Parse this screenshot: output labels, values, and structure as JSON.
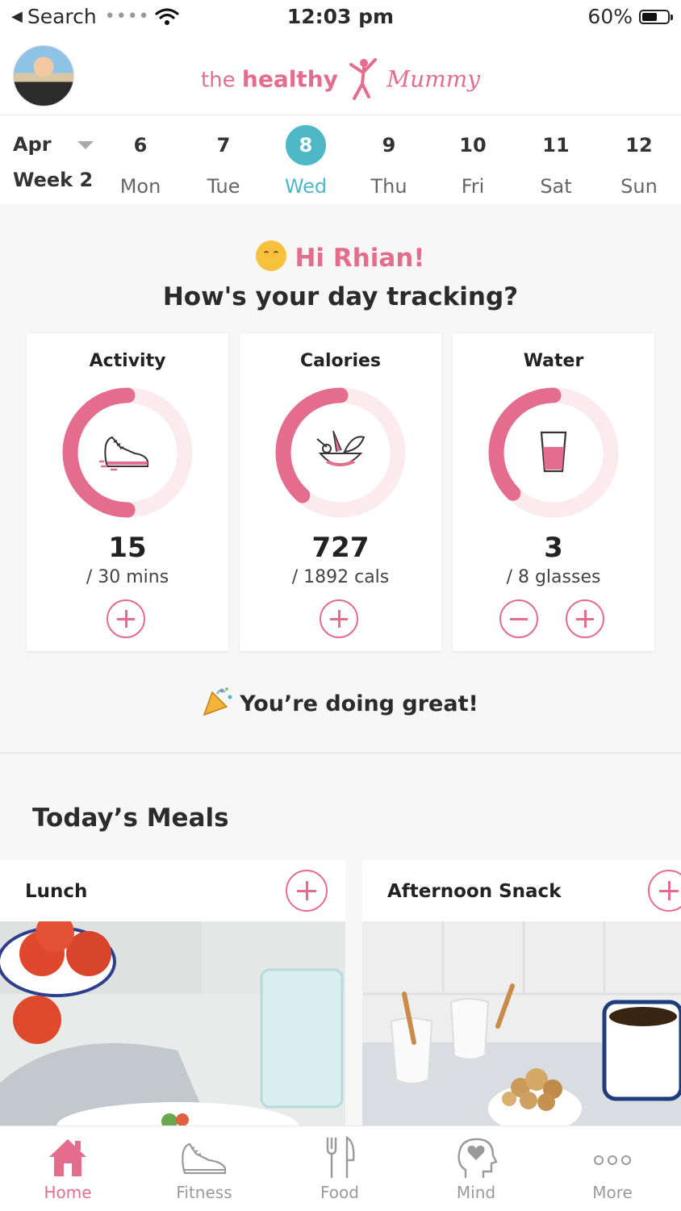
{
  "status_bar": {
    "back_app": "Search",
    "time": "12:03 pm",
    "battery": "60%",
    "battery_level": 0.6
  },
  "header": {
    "logo_the": "the",
    "logo_healthy": "healthy",
    "logo_mummy": "Mummy"
  },
  "week": {
    "month": "Apr",
    "week_label": "Week 2",
    "days": [
      {
        "num": "6",
        "name": "Mon"
      },
      {
        "num": "7",
        "name": "Tue"
      },
      {
        "num": "8",
        "name": "Wed"
      },
      {
        "num": "9",
        "name": "Thu"
      },
      {
        "num": "10",
        "name": "Fri"
      },
      {
        "num": "11",
        "name": "Sat"
      },
      {
        "num": "12",
        "name": "Sun"
      }
    ],
    "active_index": 2
  },
  "greeting": {
    "hi": "Hi Rhian!",
    "question": "How's your day tracking?"
  },
  "tracking": {
    "activity": {
      "title": "Activity",
      "value": "15",
      "target": "/ 30 mins",
      "progress": 0.5,
      "icon": "sneaker-icon"
    },
    "calories": {
      "title": "Calories",
      "value": "727",
      "target": "/ 1892 cals",
      "progress": 0.384,
      "icon": "salad-bowl-icon"
    },
    "water": {
      "title": "Water",
      "value": "3",
      "target": "/ 8 glasses",
      "progress": 0.375,
      "icon": "water-glass-icon"
    }
  },
  "encouragement": "You’re doing great!",
  "meals": {
    "title": "Today’s Meals",
    "items": [
      {
        "label": "Lunch"
      },
      {
        "label": "Afternoon Snack"
      }
    ]
  },
  "tabbar": {
    "items": [
      {
        "label": "Home",
        "icon": "home-icon"
      },
      {
        "label": "Fitness",
        "icon": "sneaker-icon"
      },
      {
        "label": "Food",
        "icon": "fork-knife-icon"
      },
      {
        "label": "Mind",
        "icon": "head-heart-icon"
      },
      {
        "label": "More",
        "icon": "more-dots-icon"
      }
    ],
    "active": "Home"
  },
  "colors": {
    "accent": "#e46d8d",
    "teal": "#4fb8c7",
    "ring_track": "#fbeaee"
  }
}
